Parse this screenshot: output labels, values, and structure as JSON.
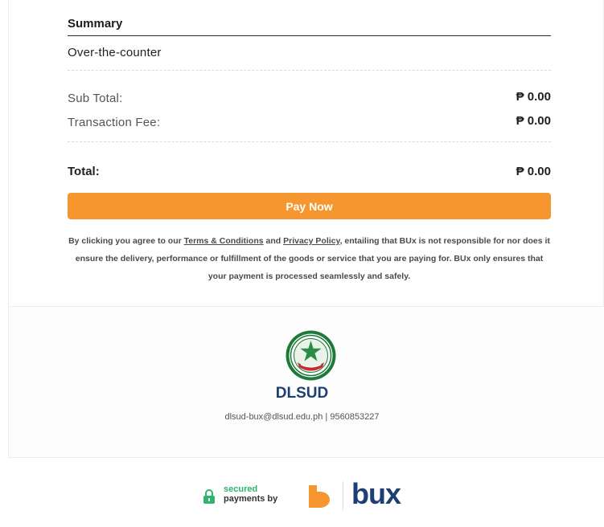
{
  "summary": {
    "title": "Summary",
    "payment_method": "Over-the-counter",
    "subtotal_label": "Sub Total:",
    "subtotal_value": "₱ 0.00",
    "fee_label": "Transaction Fee:",
    "fee_value": "₱ 0.00",
    "total_label": "Total:",
    "total_value": "₱ 0.00"
  },
  "pay_button": {
    "label": "Pay Now",
    "color": "#f6962e"
  },
  "disclaimer": {
    "prefix": "By clicking you agree to our ",
    "terms_link": "Terms & Conditions",
    "and": " and ",
    "privacy_link": "Privacy Policy",
    "suffix": ", entailing that BUx is not responsible for nor does it ensure the delivery, performance or fulfillment of the goods or service that you are paying for. BUx only ensures that your payment is processed seamlessly and safely."
  },
  "merchant": {
    "name": "DLSUD",
    "email": "dlsud-bux@dlsud.edu.ph",
    "separator": " | ",
    "phone": "9560853227",
    "brand_color": "#1d3f73"
  },
  "footer": {
    "secured_line1": "secured",
    "secured_line2": "payments by",
    "brand": "bux",
    "accent_green": "#2fb36e",
    "accent_orange": "#f6962e"
  }
}
